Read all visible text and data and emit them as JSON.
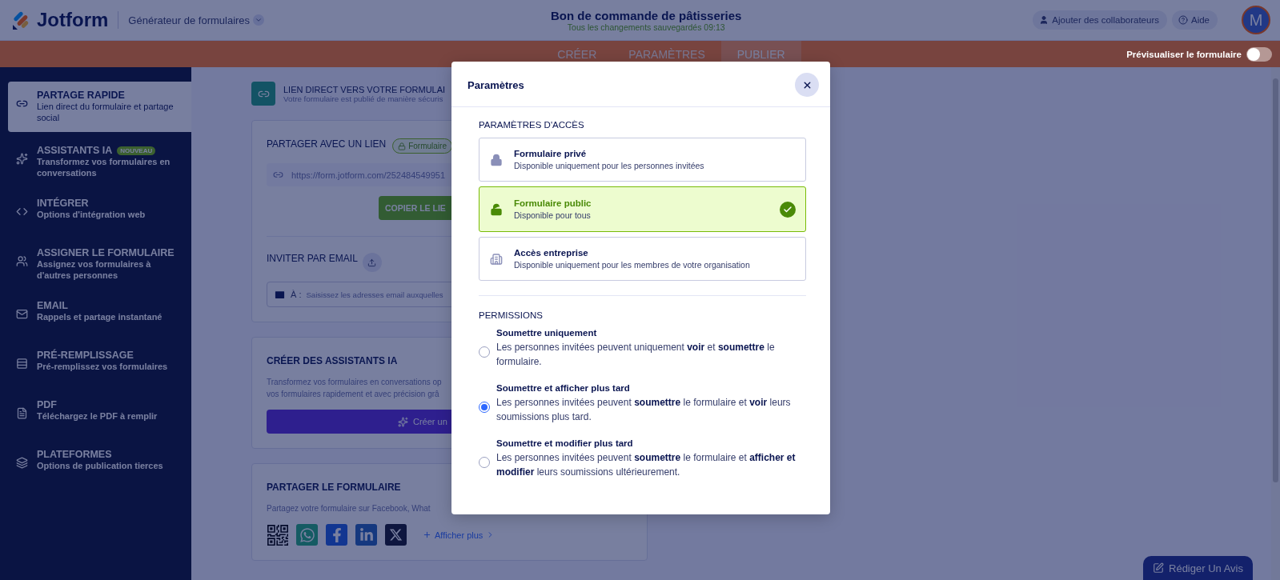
{
  "header": {
    "logo": "Jotform",
    "builder_menu": "Générateur de formulaires",
    "form_title": "Bon de commande de pâtisseries",
    "save_status": "Tous les changements sauvegardés 09:13",
    "collaborators_button": "Ajouter des collaborateurs",
    "help_button": "Aide",
    "avatar": "M"
  },
  "tabs": [
    {
      "label": "CRÉER",
      "selected": false
    },
    {
      "label": "PARAMÈTRES",
      "selected": false
    },
    {
      "label": "PUBLIER",
      "selected": true
    }
  ],
  "preview": {
    "label": "Prévisualiser le formulaire",
    "on": false
  },
  "sidebar": {
    "items": [
      {
        "title": "PARTAGE RAPIDE",
        "subtitle": "Lien direct du formulaire et partage social",
        "selected": true
      },
      {
        "title": "ASSISTANTS IA",
        "badge": "NOUVEAU",
        "subtitle": "Transformez vos formulaires en conversations",
        "selected": false
      },
      {
        "title": "INTÉGRER",
        "subtitle": "Options d'intégration web",
        "selected": false
      },
      {
        "title": "ASSIGNER LE FORMULAIRE",
        "subtitle": "Assignez vos formulaires à d'autres personnes",
        "selected": false
      },
      {
        "title": "EMAIL",
        "subtitle": "Rappels et partage instantané",
        "selected": false
      },
      {
        "title": "PRÉ-REMPLISSAGE",
        "subtitle": "Pré-remplissez vos formulaires",
        "selected": false
      },
      {
        "title": "PDF",
        "subtitle": "Téléchargez le PDF à remplir",
        "selected": false
      },
      {
        "title": "PLATEFORMES",
        "subtitle": "Options de publication tierces",
        "selected": false
      }
    ]
  },
  "direct_link": {
    "title": "LIEN DIRECT VERS VOTRE FORMULAI",
    "subtitle": "Votre formulaire est publié de manière sécuris"
  },
  "share_link": {
    "title": "PARTAGER AVEC UN LIEN",
    "status_badge": "Formulaire",
    "url": "https://form.jotform.com/252484549951",
    "copy_button": "COPIER LE LIE"
  },
  "invite_email": {
    "title": "INVITER PAR EMAIL",
    "to_label": "À :",
    "placeholder": "Saisissez les adresses email auxquelles"
  },
  "ai_assistants": {
    "title": "CRÉER DES ASSISTANTS IA",
    "description_lines": [
      "Transformez vos formulaires en conversations op",
      "vos formulaires rapidement et avec précision grâ"
    ],
    "create_button": "Créer un"
  },
  "share_form": {
    "title": "PARTAGER LE FORMULAIRE",
    "description": "Partagez votre formulaire sur Facebook, What",
    "show_more": "Afficher plus"
  },
  "review_button": "Rédiger Un Avis",
  "modal": {
    "title": "Paramètres",
    "access_title": "PARAMÈTRES D'ACCÈS",
    "access_options": [
      {
        "title": "Formulaire privé",
        "description": "Disponible uniquement pour les personnes invitées",
        "selected": false
      },
      {
        "title": "Formulaire public",
        "description": "Disponible pour tous",
        "selected": true
      },
      {
        "title": "Accès entreprise",
        "description": "Disponible uniquement pour les membres de votre organisation",
        "selected": false
      }
    ],
    "permissions_title": "PERMISSIONS",
    "permissions": [
      {
        "title": "Soumettre uniquement",
        "description": "Les personnes invitées peuvent uniquement **voir** et **soumettre** le formulaire.",
        "selected": false
      },
      {
        "title": "Soumettre et afficher plus tard",
        "description": "Les personnes invitées peuvent **soumettre** le formulaire et **voir** leurs soumissions plus tard.",
        "selected": true
      },
      {
        "title": "Soumettre et modifier plus tard",
        "description": "Les personnes invitées peuvent **soumettre** le formulaire et **afficher et modifier** leurs soumissions ultérieurement.",
        "selected": false
      }
    ]
  }
}
